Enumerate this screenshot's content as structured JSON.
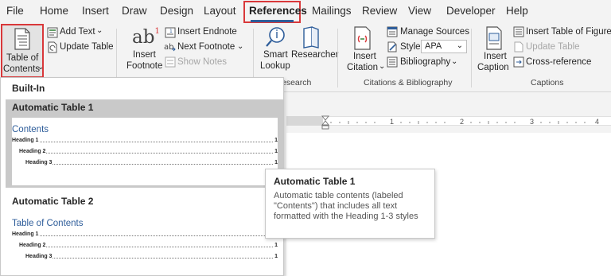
{
  "tabs": [
    "File",
    "Home",
    "Insert",
    "Draw",
    "Design",
    "Layout",
    "References",
    "Mailings",
    "Review",
    "View",
    "Developer",
    "Help"
  ],
  "ribbon": {
    "toc": {
      "line1": "Table of",
      "line2": "Contents",
      "chevron": "⌄"
    },
    "add_text": "Add Text",
    "add_text_chevron": "⌄",
    "update_table": "Update Table",
    "insert_footnote_line1": "Insert",
    "insert_footnote_line2": "Footnote",
    "footnote_glyph": "ab",
    "footnote_super": "1",
    "insert_endnote": "Insert Endnote",
    "next_footnote": "Next Footnote",
    "next_footnote_chevron": "⌄",
    "show_notes": "Show Notes",
    "smart_lookup_line1": "Smart",
    "smart_lookup_line2": "Lookup",
    "researcher": "Researcher",
    "research_group": "esearch",
    "insert_citation_line1": "Insert",
    "insert_citation_line2": "Citation",
    "insert_citation_chevron": "⌄",
    "manage_sources": "Manage Sources",
    "style_label": "Style:",
    "style_value": "APA",
    "style_chevron": "⌄",
    "bibliography": "Bibliography",
    "bibliography_chevron": "⌄",
    "citations_group": "Citations & Bibliography",
    "insert_caption_line1": "Insert",
    "insert_caption_line2": "Caption",
    "insert_table_of_figures": "Insert Table of Figures",
    "update_table_captions": "Update Table",
    "cross_reference": "Cross-reference",
    "captions_group": "Captions"
  },
  "ruler": {
    "marks": [
      "1",
      "2",
      "3",
      "4"
    ]
  },
  "gallery": {
    "section": "Built-In",
    "items": [
      {
        "title": "Automatic Table 1",
        "heading": "Contents",
        "entries": [
          {
            "label": "Heading 1",
            "page": "1"
          },
          {
            "label": "Heading 2",
            "page": "1"
          },
          {
            "label": "Heading 3",
            "page": "1"
          }
        ]
      },
      {
        "title": "Automatic Table 2",
        "heading": "Table of Contents",
        "entries": [
          {
            "label": "Heading 1",
            "page": "1"
          },
          {
            "label": "Heading 2",
            "page": "1"
          },
          {
            "label": "Heading 3",
            "page": "1"
          }
        ]
      }
    ]
  },
  "tooltip": {
    "title": "Automatic Table 1",
    "description": "Automatic table contents (labeled \"Contents\") that includes all text formatted with the Heading 1-3 styles"
  }
}
